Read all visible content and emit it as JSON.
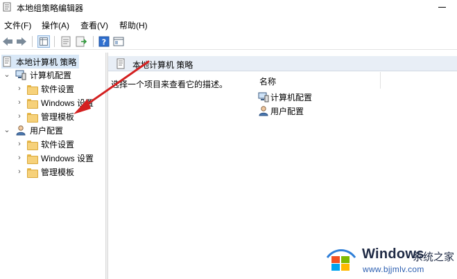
{
  "window": {
    "title": "本地组策略编辑器"
  },
  "menu": {
    "items": [
      {
        "label": "文件(F)"
      },
      {
        "label": "操作(A)"
      },
      {
        "label": "查看(V)"
      },
      {
        "label": "帮助(H)"
      }
    ]
  },
  "toolbar": {
    "buttons": [
      "back-icon",
      "forward-icon",
      "show-hide-tree-icon",
      "properties-icon",
      "export-list-icon",
      "help-icon",
      "extended-view-icon"
    ]
  },
  "tree": {
    "root": "本地计算机 策略",
    "computer_config": "计算机配置",
    "user_config": "用户配置",
    "software_settings": "软件设置",
    "windows_settings": "Windows 设置",
    "admin_templates": "管理模板"
  },
  "content": {
    "header_title": "本地计算机 策略",
    "description": "选择一个项目来查看它的描述。",
    "column_name": "名称",
    "items": [
      {
        "label": "计算机配置",
        "icon": "computer-icon"
      },
      {
        "label": "用户配置",
        "icon": "user-icon"
      }
    ]
  },
  "annotation": {
    "arrow_color": "#d42020"
  },
  "watermark": {
    "title": "Windows",
    "subtitle": "系统之家",
    "url": "www.bjjmlv.com"
  },
  "colors": {
    "selected_bg": "#d9e8f7",
    "header_band": "#e8eef6",
    "folder": "#f6d17a"
  }
}
